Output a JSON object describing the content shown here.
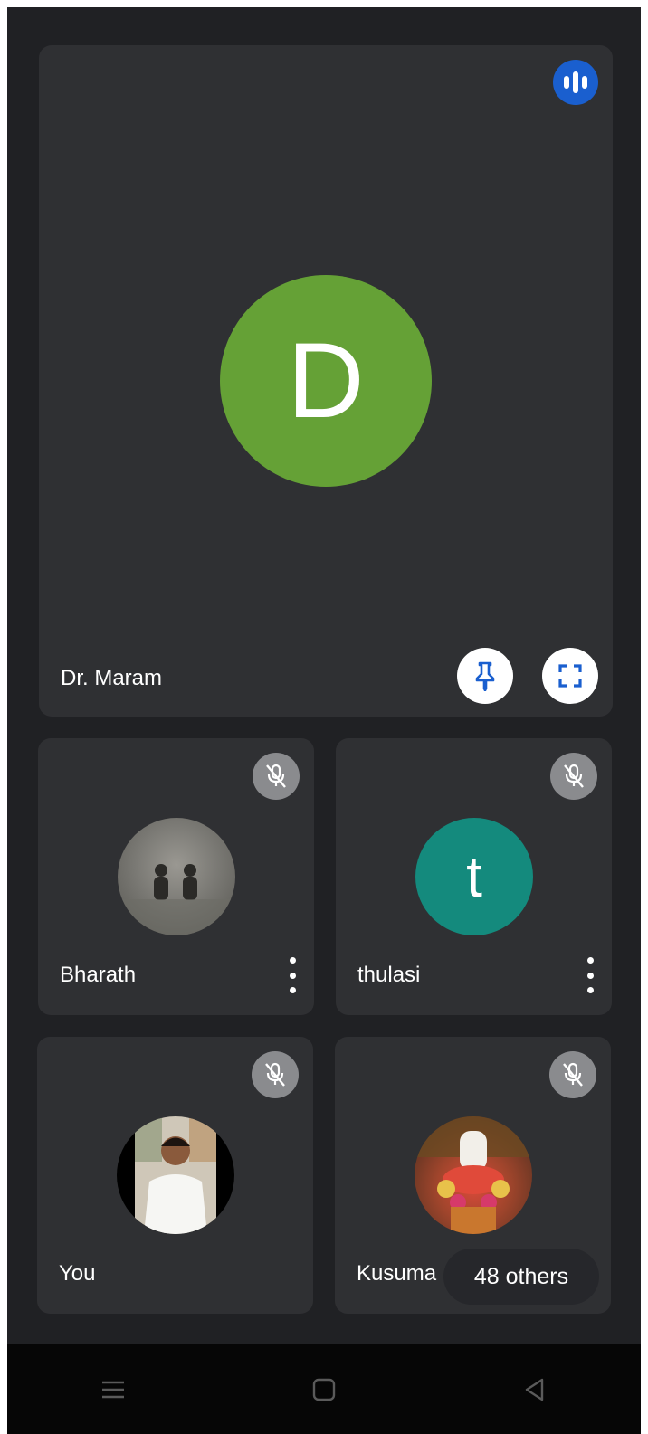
{
  "main_participant": {
    "name": "Dr. Maram",
    "initial": "D",
    "avatar_color": "#65a136",
    "speaking_icon": "audio-wave-icon",
    "pin_icon": "pin-icon",
    "fullscreen_icon": "fullscreen-icon"
  },
  "participants": [
    {
      "name": "Bharath",
      "avatar": "photo",
      "muted": true,
      "has_menu": true
    },
    {
      "name": "thulasi",
      "avatar": "letter",
      "initial": "t",
      "avatar_color": "#148a7d",
      "muted": true,
      "has_menu": true
    },
    {
      "name": "You",
      "avatar": "photo",
      "muted": true,
      "has_menu": false
    },
    {
      "name": "Kusuma",
      "avatar": "photo",
      "muted": true,
      "has_menu": false
    }
  ],
  "others": {
    "label": "48 others"
  },
  "navbar": {
    "items": [
      "menu-icon",
      "home-icon",
      "back-icon"
    ]
  },
  "colors": {
    "background": "#202124",
    "tile": "#2f3033",
    "accent": "#1a5fcf",
    "mute_badge": "#8a8b8e"
  }
}
